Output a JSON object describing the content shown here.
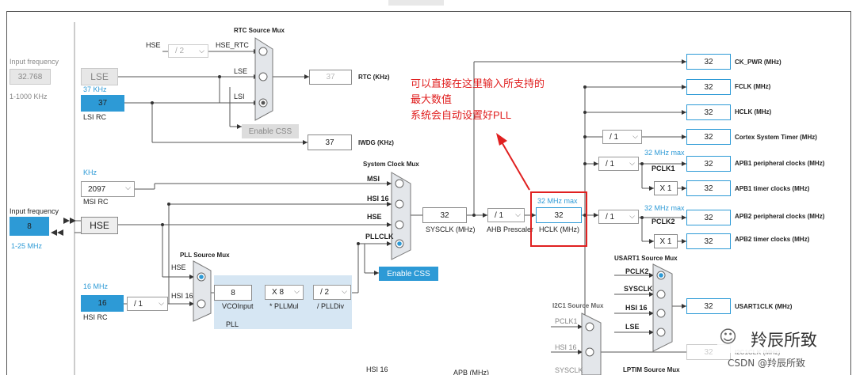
{
  "input_freq_left": {
    "label": "Input frequency",
    "value": "32.768",
    "range": "1-1000 KHz"
  },
  "lse": {
    "label": "LSE"
  },
  "lsi": {
    "freq_label": "37 KHz",
    "value": "37",
    "caption": "LSI RC"
  },
  "rtc_mux": {
    "title": "RTC Source Mux",
    "inputs": [
      "HSE",
      "HSE_RTC",
      "LSE",
      "LSI"
    ],
    "hse_div": "/ 2",
    "rtc_value": "37",
    "rtc_label": "RTC (KHz)"
  },
  "enable_css_top": "Enable CSS",
  "iwdg": {
    "value": "37",
    "label": "IWDG (KHz)"
  },
  "msi": {
    "unit": "KHz",
    "value": "2097",
    "caption": "MSI RC"
  },
  "hse_input": {
    "label": "Input frequency",
    "value": "8",
    "range": "1-25 MHz",
    "box": "HSE"
  },
  "hsi": {
    "freq": "16 MHz",
    "value": "16",
    "caption": "HSI RC",
    "div": "/ 1"
  },
  "sysclk_mux": {
    "title": "System Clock Mux",
    "inputs": [
      "MSI",
      "HSI 16",
      "HSE",
      "PLLCLK"
    ]
  },
  "enable_css_main": "Enable CSS",
  "sysclk": {
    "value": "32",
    "label": "SYSCLK (MHz)"
  },
  "ahb": {
    "div": "/ 1",
    "label": "AHB Prescaler"
  },
  "hclk": {
    "max": "32 MHz max",
    "value": "32",
    "label": "HCLK (MHz)"
  },
  "pll": {
    "title": "PLL Source Mux",
    "inputs": [
      "HSE",
      "HSI 16"
    ],
    "vco_value": "8",
    "vco_label": "VCOInput",
    "mul": "X 8",
    "mul_label": "* PLLMul",
    "div": "/ 2",
    "div_label": "/ PLLDiv",
    "caption": "PLL"
  },
  "outputs": [
    {
      "value": "32",
      "label": "CK_PWR (MHz)"
    },
    {
      "value": "32",
      "label": "FCLK (MHz)"
    },
    {
      "value": "32",
      "label": "HCLK (MHz)"
    },
    {
      "value": "32",
      "label": "Cortex System Timer (MHz)"
    },
    {
      "value": "32",
      "label": "APB1 peripheral clocks (MHz)"
    },
    {
      "value": "32",
      "label": "APB1 timer clocks (MHz)"
    },
    {
      "value": "32",
      "label": "APB2 peripheral clocks (MHz)"
    },
    {
      "value": "32",
      "label": "APB2 timer clocks (MHz)"
    }
  ],
  "cortex_div": "/ 1",
  "apb1": {
    "max": "32 MHz max",
    "div": "/ 1",
    "pclk": "PCLK1",
    "timer_mul": "X 1"
  },
  "apb2": {
    "max": "32 MHz max",
    "div": "/ 1",
    "pclk": "PCLK2",
    "timer_mul": "X 1"
  },
  "usart1": {
    "title": "USART1 Source Mux",
    "inputs": [
      "PCLK2",
      "SYSCLK",
      "HSI 16",
      "LSE"
    ],
    "value": "32",
    "label": "USART1CLK (MHz)"
  },
  "i2c1": {
    "title": "I2C1 Source Mux",
    "inputs": [
      "PCLK1",
      "HSI 16",
      "SYSCLK"
    ],
    "value": "32",
    "label": "I2C1CLK (MHz)"
  },
  "lptim": {
    "title": "LPTIM Source Mux"
  },
  "bottom_hsi": "HSI 16",
  "bottom_label": "APB (MHz)",
  "annotation": [
    "可以直接在这里输入所支持的",
    "最大数值",
    "系统会自动设置好PLL"
  ],
  "watermark": {
    "brand": "羚辰所致",
    "csdn": "CSDN @羚辰所致"
  }
}
